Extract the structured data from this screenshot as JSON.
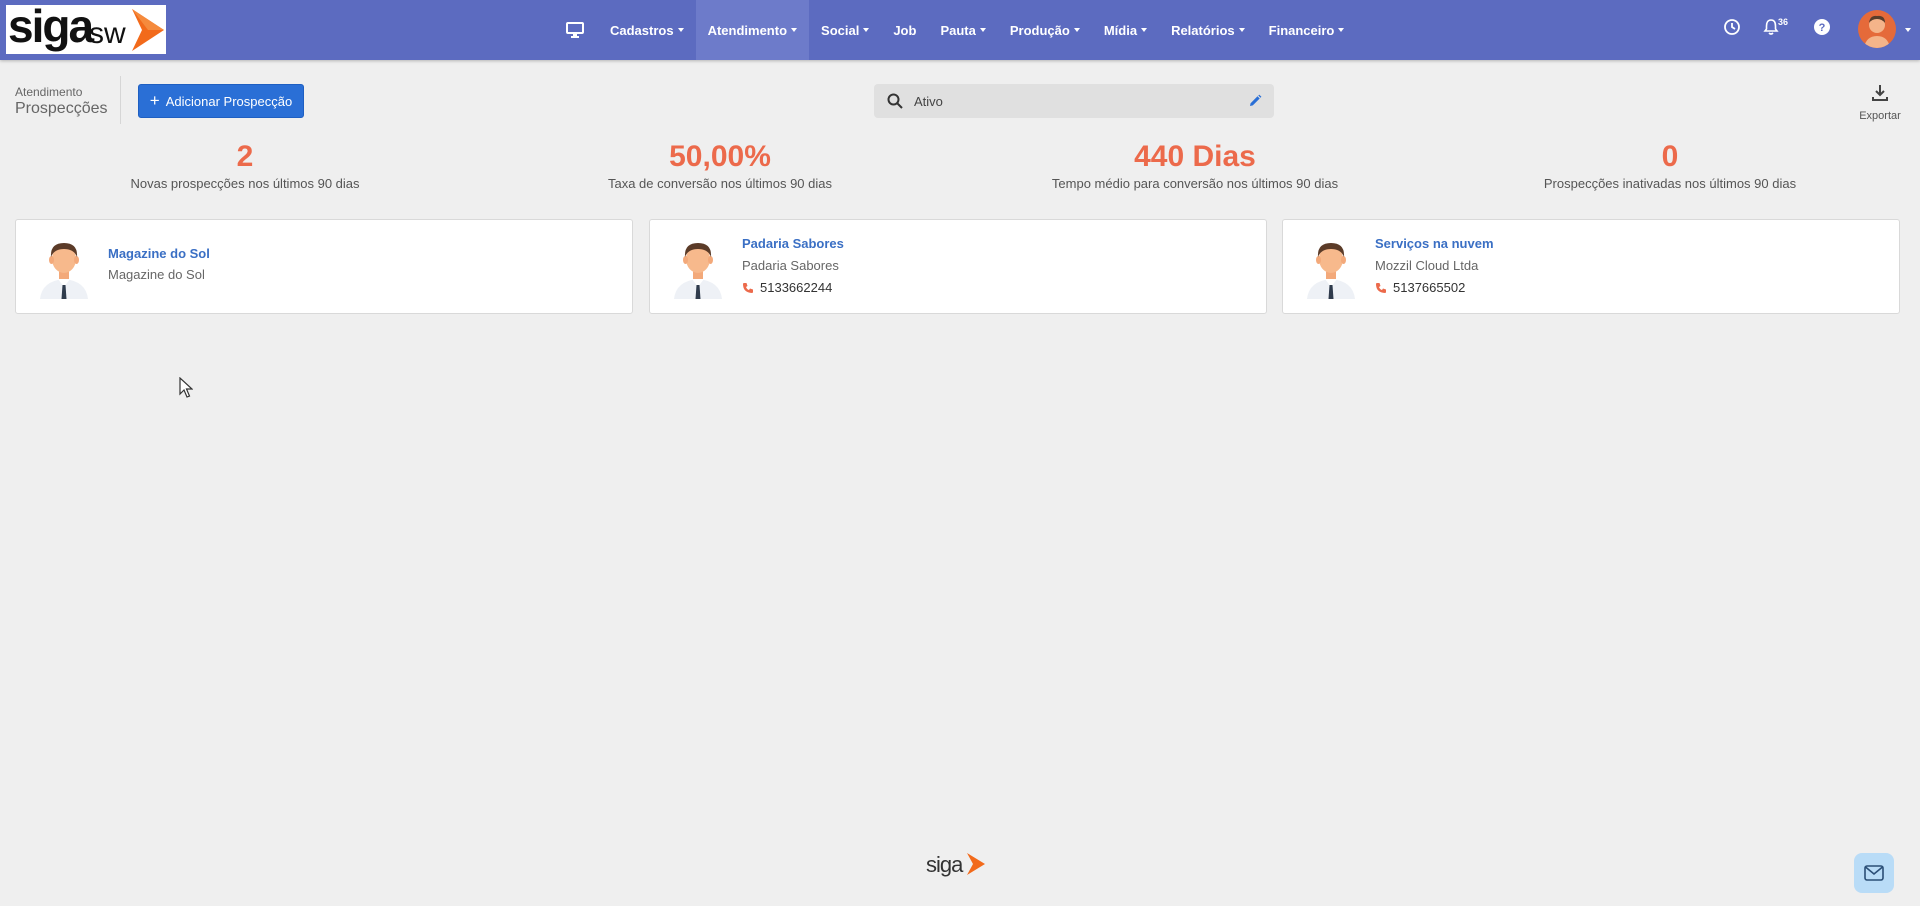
{
  "brand": {
    "logo_main": "siga",
    "logo_suffix": "sw",
    "footer_logo": "siga"
  },
  "nav": {
    "items": [
      {
        "label": "Cadastros",
        "dropdown": true
      },
      {
        "label": "Atendimento",
        "dropdown": true,
        "active": true
      },
      {
        "label": "Social",
        "dropdown": true
      },
      {
        "label": "Job",
        "dropdown": false
      },
      {
        "label": "Pauta",
        "dropdown": true
      },
      {
        "label": "Produção",
        "dropdown": true
      },
      {
        "label": "Mídia",
        "dropdown": true
      },
      {
        "label": "Relatórios",
        "dropdown": true
      },
      {
        "label": "Financeiro",
        "dropdown": true
      }
    ],
    "notifications_count": "36",
    "icons": [
      "desktop-icon",
      "clock-icon",
      "bell-icon",
      "help-icon",
      "user-avatar"
    ]
  },
  "header": {
    "breadcrumb_parent": "Atendimento",
    "page_title": "Prospecções",
    "add_button_label": "Adicionar Prospecção",
    "search_value": "Ativo",
    "export_label": "Exportar"
  },
  "stats": [
    {
      "value": "2",
      "label": "Novas prospecções nos últimos 90 dias"
    },
    {
      "value": "50,00%",
      "label": "Taxa de conversão nos últimos 90 dias"
    },
    {
      "value": "440 Dias",
      "label": "Tempo médio para conversão nos últimos 90 dias"
    },
    {
      "value": "0",
      "label": "Prospecções inativadas nos últimos 90 dias"
    }
  ],
  "cards": [
    {
      "name": "Magazine do Sol",
      "company": "Magazine do Sol",
      "phone": ""
    },
    {
      "name": "Padaria Sabores",
      "company": "Padaria Sabores",
      "phone": "5133662244"
    },
    {
      "name": "Serviços na nuvem",
      "company": "Mozzil Cloud Ltda",
      "phone": "5137665502"
    }
  ],
  "colors": {
    "nav_bg": "#5c6bc0",
    "accent": "#ec6a4b",
    "primary_button": "#2a6fd6",
    "link": "#3a6fc4"
  }
}
